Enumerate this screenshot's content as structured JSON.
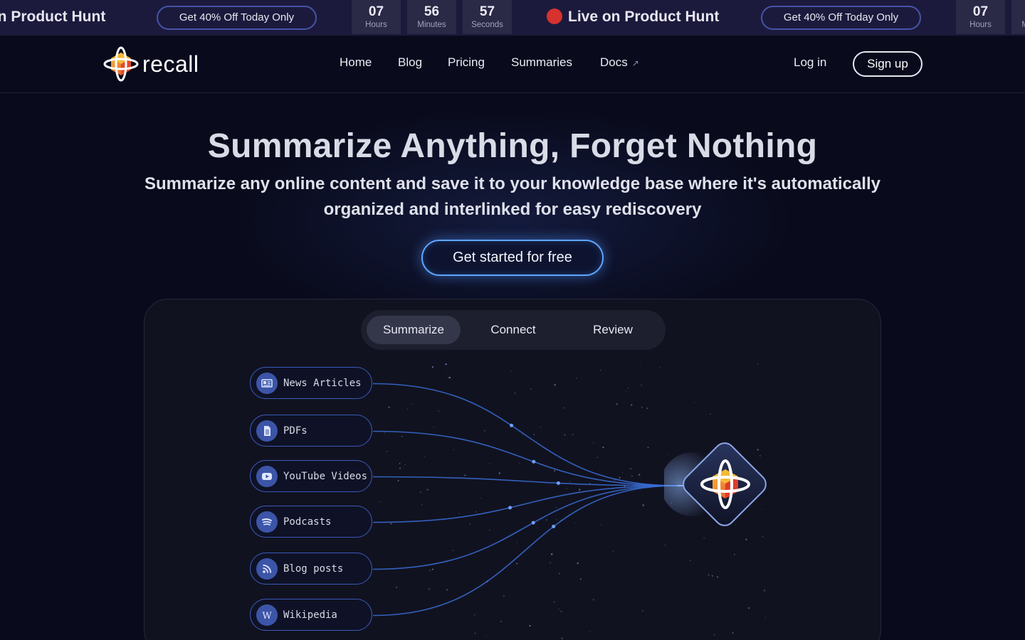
{
  "banner": {
    "live_text": "Live on Product Hunt",
    "offer_label": "Get 40% Off Today Only",
    "countdown": {
      "hours": "07",
      "hours_label": "Hours",
      "minutes": "56",
      "minutes_label": "Minutes",
      "seconds": "57",
      "seconds_label": "Seconds"
    },
    "colors": {
      "background": "#1c1a3c",
      "dot": "#d7322d",
      "offer_border": "#4654a8"
    }
  },
  "nav": {
    "logo_text": "recall",
    "links": [
      "Home",
      "Blog",
      "Pricing",
      "Summaries",
      "Docs"
    ],
    "docs_external_icon": "arrow-up-right-icon",
    "login_label": "Log in",
    "signup_label": "Sign up"
  },
  "hero": {
    "title": "Summarize Anything, Forget Nothing",
    "subtitle": "Summarize any online content and save it to your knowledge base where it's automatically organized and interlinked for easy rediscovery",
    "cta_label": "Get started for free",
    "cta_glow_color": "#5fa6ff"
  },
  "demo": {
    "tabs": [
      "Summarize",
      "Connect",
      "Review"
    ],
    "active_tab": "Summarize",
    "sources": [
      {
        "label": "News Articles",
        "icon": "newspaper-icon"
      },
      {
        "label": "PDFs",
        "icon": "document-icon"
      },
      {
        "label": "YouTube Videos",
        "icon": "youtube-icon"
      },
      {
        "label": "Podcasts",
        "icon": "spotify-icon"
      },
      {
        "label": "Blog posts",
        "icon": "rss-icon"
      },
      {
        "label": "Wikipedia",
        "icon": "wikipedia-icon"
      }
    ],
    "hub_icon": "recall-logo-icon",
    "colors": {
      "wire": "#3a6fd8",
      "source_border": "#3a5ab8",
      "panel": "#111220"
    }
  }
}
